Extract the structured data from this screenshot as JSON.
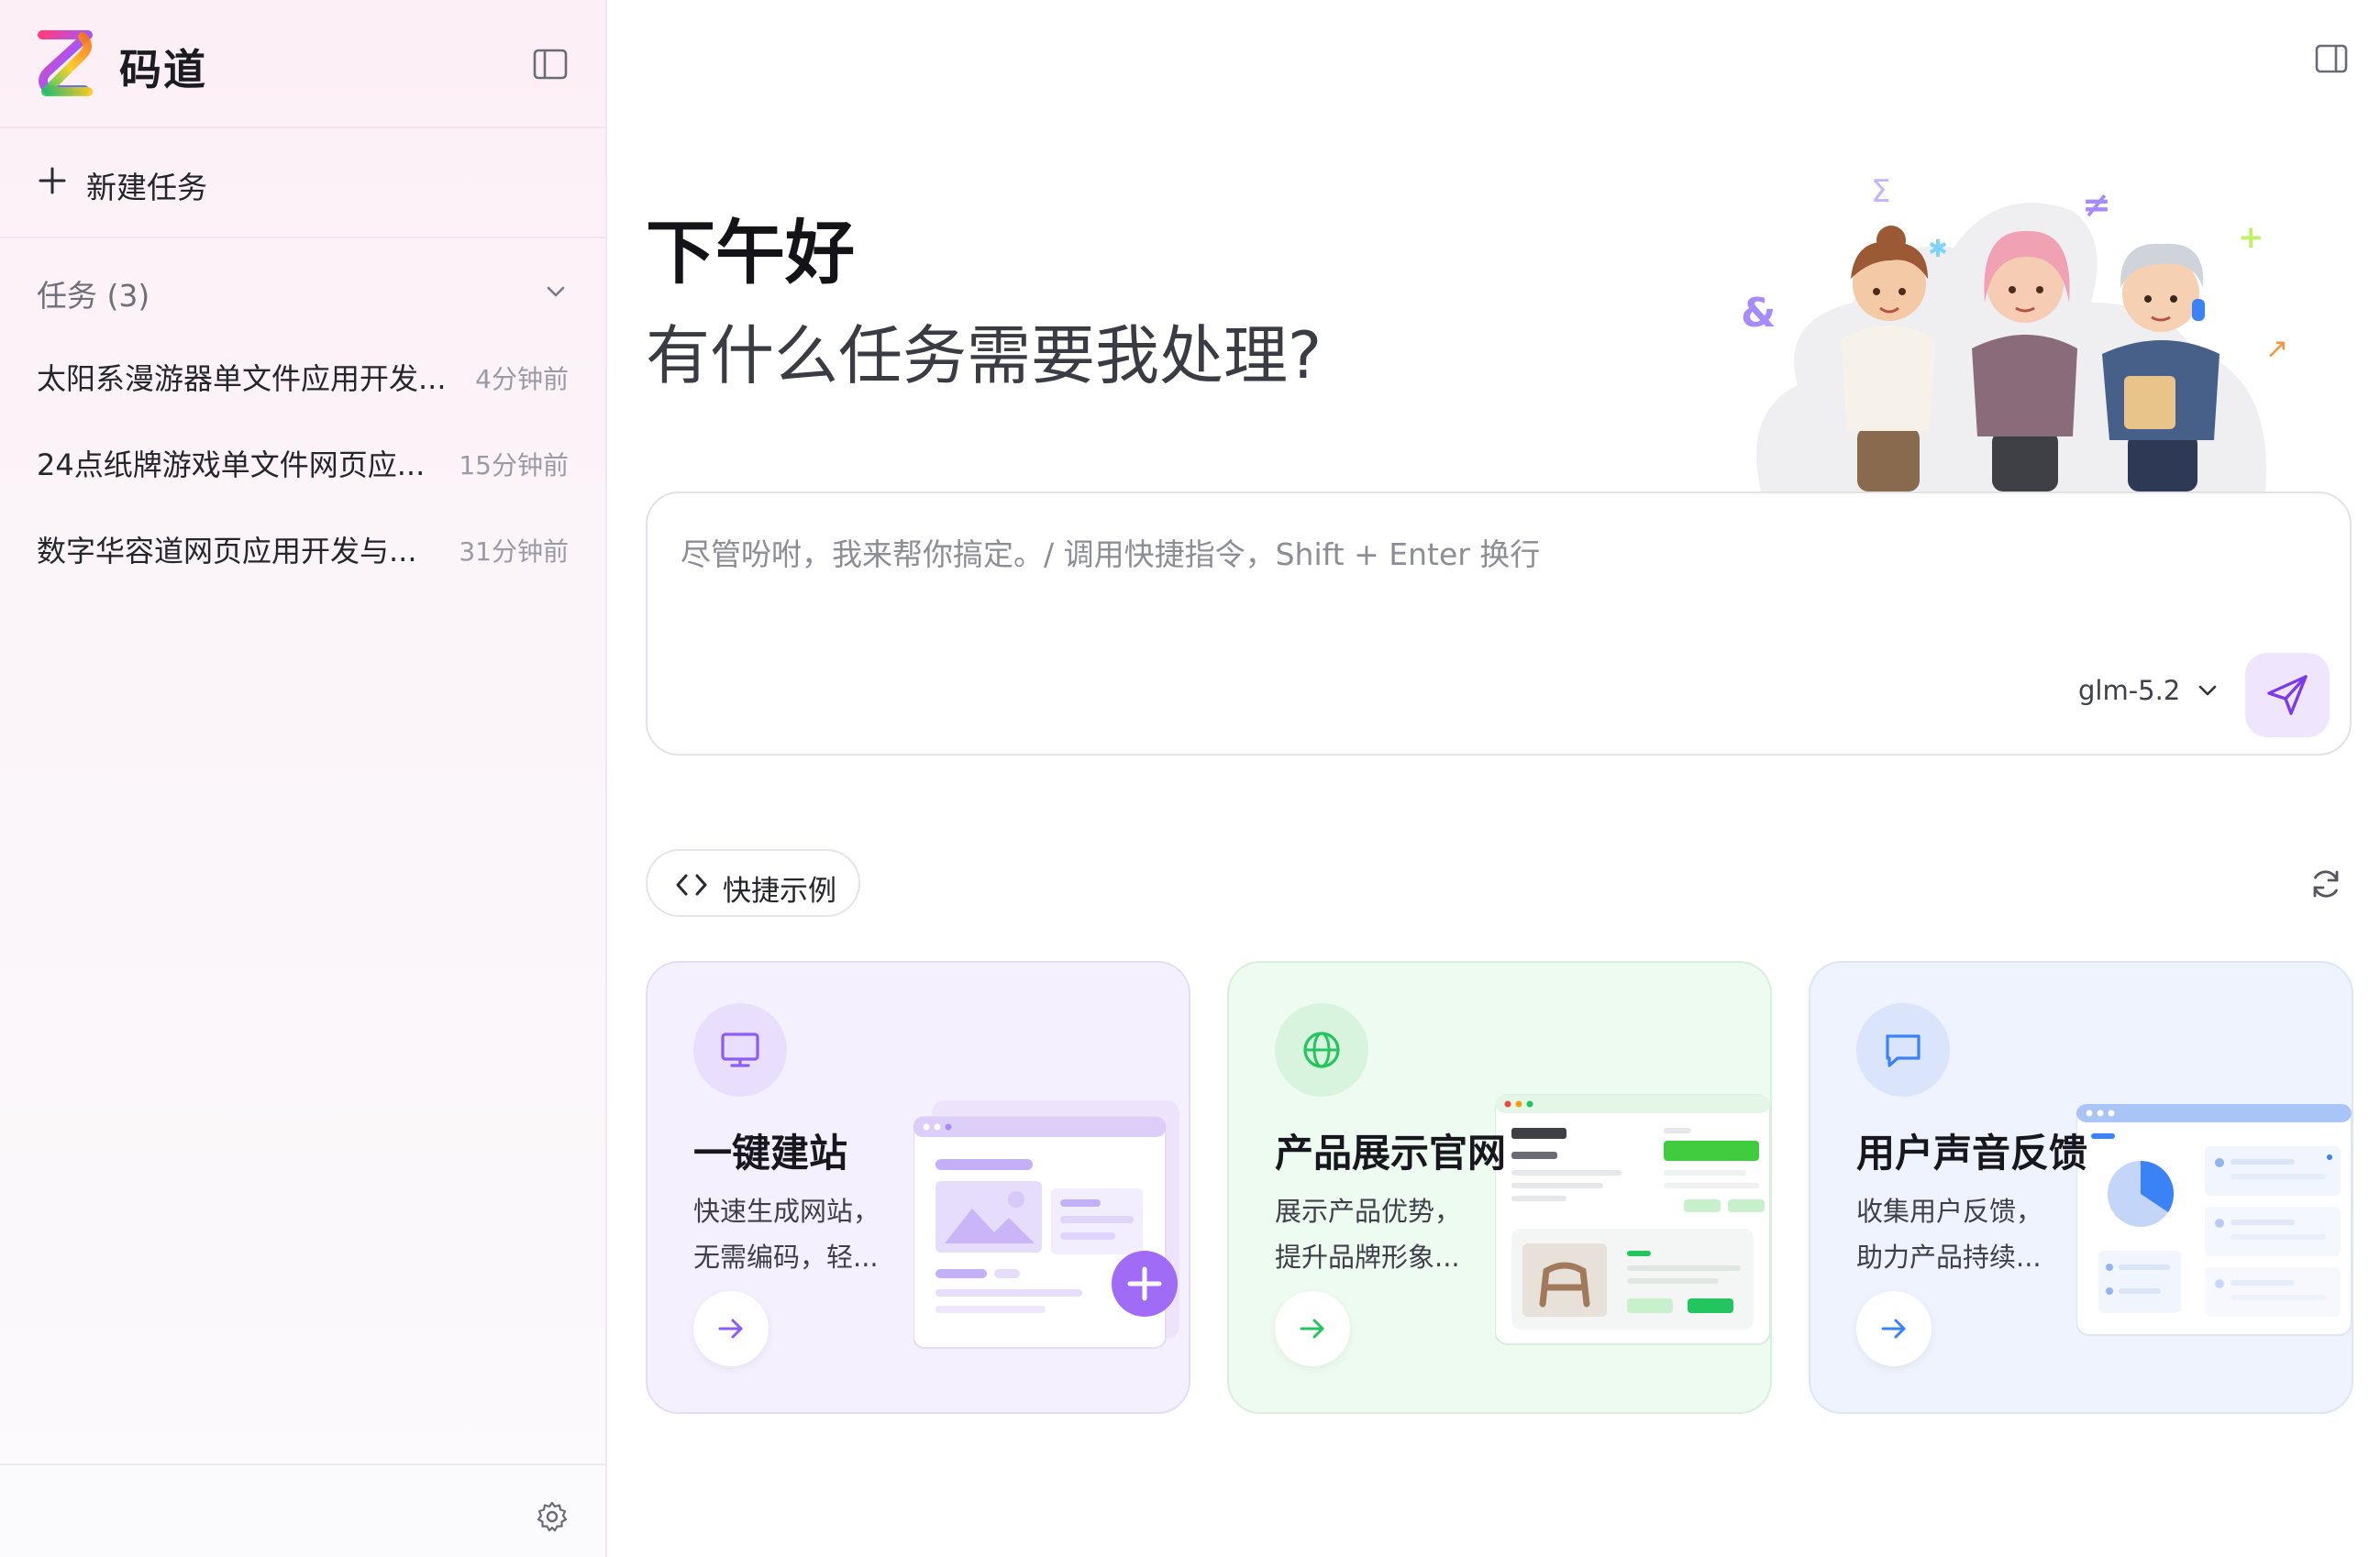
{
  "sidebar": {
    "brand": "码道",
    "new_task_label": "新建任务",
    "task_group_label": "任务 (3)",
    "tasks": [
      {
        "title": "太阳系漫游器单文件应用开发...",
        "time": "4分钟前"
      },
      {
        "title": "24点纸牌游戏单文件网页应...",
        "time": "15分钟前"
      },
      {
        "title": "数字华容道网页应用开发与...",
        "time": "31分钟前"
      }
    ]
  },
  "main": {
    "greeting": "下午好",
    "question": "有什么任务需要我处理?",
    "input": {
      "value": "",
      "placeholder": "尽管吩咐，我来帮你搞定。/ 调用快捷指令，Shift + Enter 换行"
    },
    "model": {
      "selected": "glm-5.2"
    },
    "examples_label": "快捷示例",
    "cards": [
      {
        "title": "一键建站",
        "desc": "快速生成网站，无需编码，轻...",
        "accent": "#8b5cf6",
        "icon": "monitor-icon"
      },
      {
        "title": "产品展示官网",
        "desc": "展示产品优势，提升品牌形象...",
        "accent": "#22c55e",
        "icon": "globe-icon"
      },
      {
        "title": "用户声音反馈",
        "desc": "收集用户反馈，助力产品持续...",
        "accent": "#3b82f6",
        "icon": "chat-icon"
      }
    ]
  },
  "colors": {
    "accent_purple": "#8b5cf6",
    "accent_green": "#22c55e",
    "accent_blue": "#3b82f6"
  }
}
